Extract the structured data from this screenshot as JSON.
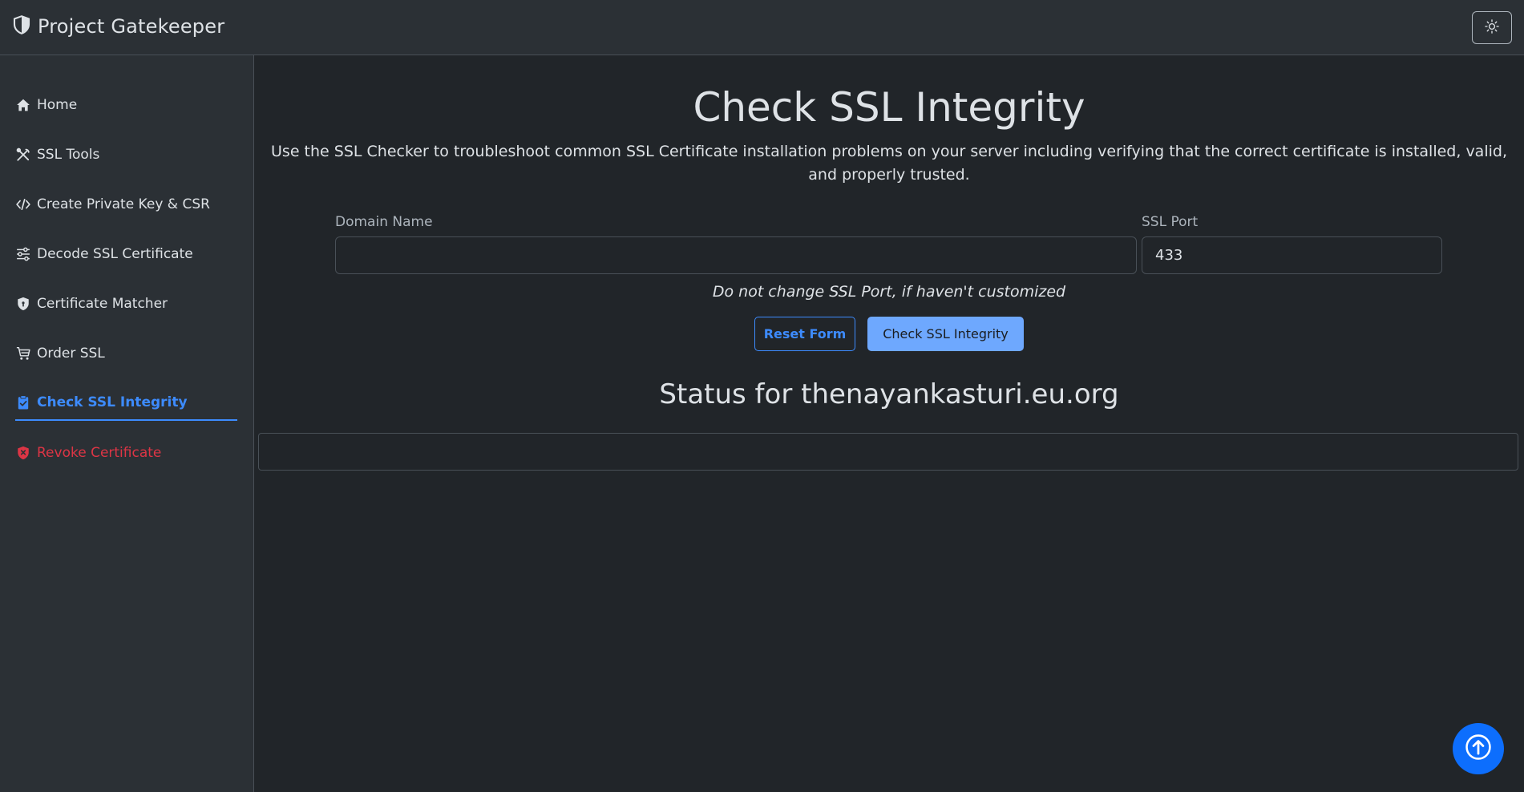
{
  "app": {
    "title": "Project Gatekeeper"
  },
  "sidebar": {
    "items": [
      {
        "label": "Home",
        "icon": "home-icon"
      },
      {
        "label": "SSL Tools",
        "icon": "tools-icon"
      },
      {
        "label": "Create Private Key & CSR",
        "icon": "code-icon"
      },
      {
        "label": "Decode SSL Certificate",
        "icon": "sliders-icon"
      },
      {
        "label": "Certificate Matcher",
        "icon": "shield-icon"
      },
      {
        "label": "Order SSL",
        "icon": "cart-icon"
      },
      {
        "label": "Check SSL Integrity",
        "icon": "clipboard-check-icon",
        "active": true
      },
      {
        "label": "Revoke Certificate",
        "icon": "shield-x-icon",
        "danger": true
      }
    ]
  },
  "main": {
    "title": "Check SSL Integrity",
    "description": "Use the SSL Checker to troubleshoot common SSL Certificate installation problems on your server including verifying that the correct certificate is installed, valid, and properly trusted.",
    "form": {
      "domain_label": "Domain Name",
      "domain_value": "",
      "port_label": "SSL Port",
      "port_value": "433",
      "hint": "Do not change SSL Port, if haven't customized",
      "reset_label": "Reset Form",
      "submit_label": "Check SSL Integrity"
    },
    "status": {
      "title": "Status for thenayankasturi.eu.org",
      "content": ""
    }
  },
  "colors": {
    "background": "#212529",
    "panel": "#2b3035",
    "accent": "#3d8bfd",
    "primary_button": "#6ea8fe",
    "danger": "#dc3545",
    "scroll_button": "#0d6efd"
  }
}
